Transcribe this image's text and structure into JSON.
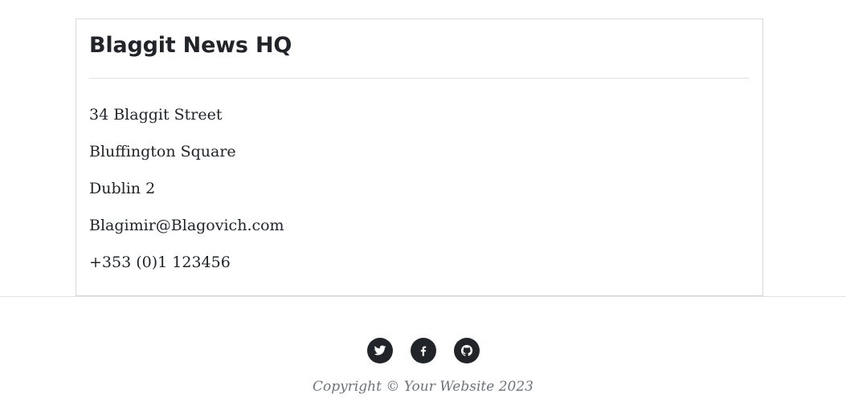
{
  "contact_card": {
    "title": "Blaggit News HQ",
    "lines": [
      "34 Blaggit Street",
      "Bluffington Square",
      "Dublin 2",
      "Blagimir@Blagovich.com",
      "+353 (0)1 123456"
    ]
  },
  "footer": {
    "social_links": [
      {
        "icon": "twitter-icon"
      },
      {
        "icon": "facebook-icon"
      },
      {
        "icon": "github-icon"
      }
    ],
    "copyright": "Copyright © Your Website 2023"
  },
  "colors": {
    "text": "#212529",
    "muted": "#6c757d",
    "icon_bg": "#212529",
    "border": "#d9d9d9"
  }
}
